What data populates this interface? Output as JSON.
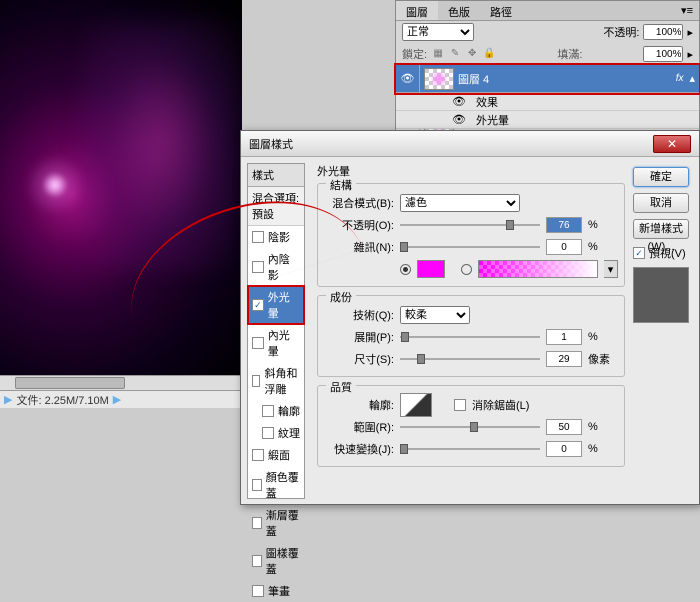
{
  "canvas": {},
  "statusbar": {
    "doc_info": "文件: 2.25M/7.10M"
  },
  "layerspanel": {
    "tabs": [
      "圖層",
      "色版",
      "路徑"
    ],
    "blend_mode": "正常",
    "opacity_label": "不透明:",
    "opacity_val": "100%",
    "lock_label": "鎖定:",
    "fill_label": "填滿:",
    "fill_val": "100%",
    "layers": [
      {
        "name": "圖層 4",
        "fx": "fx"
      },
      {
        "name": "圖層"
      }
    ],
    "sub_effects": "效果",
    "sub_outerglow": "外光暈"
  },
  "dialog": {
    "title": "圖層樣式",
    "styles_header": "樣式",
    "blend_options": "混合選項: 預設",
    "style_list": [
      {
        "label": "陰影",
        "on": false
      },
      {
        "label": "內陰影",
        "on": false
      },
      {
        "label": "外光暈",
        "on": true,
        "sel": true,
        "hl": true
      },
      {
        "label": "內光暈",
        "on": false
      },
      {
        "label": "斜角和浮雕",
        "on": false
      },
      {
        "label": "輪廓",
        "on": false,
        "indent": true
      },
      {
        "label": "紋理",
        "on": false,
        "indent": true
      },
      {
        "label": "緞面",
        "on": false
      },
      {
        "label": "顏色覆蓋",
        "on": false
      },
      {
        "label": "漸層覆蓋",
        "on": false
      },
      {
        "label": "圖樣覆蓋",
        "on": false
      },
      {
        "label": "筆畫",
        "on": false
      }
    ],
    "section_title": "外光暈",
    "grp_structure": "結構",
    "blend_mode_label": "混合模式(B):",
    "blend_mode_val": "濾色",
    "opacity_label": "不透明(O):",
    "opacity_val": "76",
    "noise_label": "雜訊(N):",
    "noise_val": "0",
    "pct": "%",
    "grp_elements": "成份",
    "technique_label": "技術(Q):",
    "technique_val": "較柔",
    "spread_label": "展開(P):",
    "spread_val": "1",
    "size_label": "尺寸(S):",
    "size_val": "29",
    "px": "像素",
    "grp_quality": "品質",
    "contour_label": "輪廓:",
    "antialias_label": "消除鋸齒(L)",
    "range_label": "範圍(R):",
    "range_val": "50",
    "jitter_label": "快速變換(J):",
    "jitter_val": "0",
    "btn_ok": "確定",
    "btn_cancel": "取消",
    "btn_newstyle": "新增樣式(W)...",
    "preview_label": "預視(V)"
  }
}
